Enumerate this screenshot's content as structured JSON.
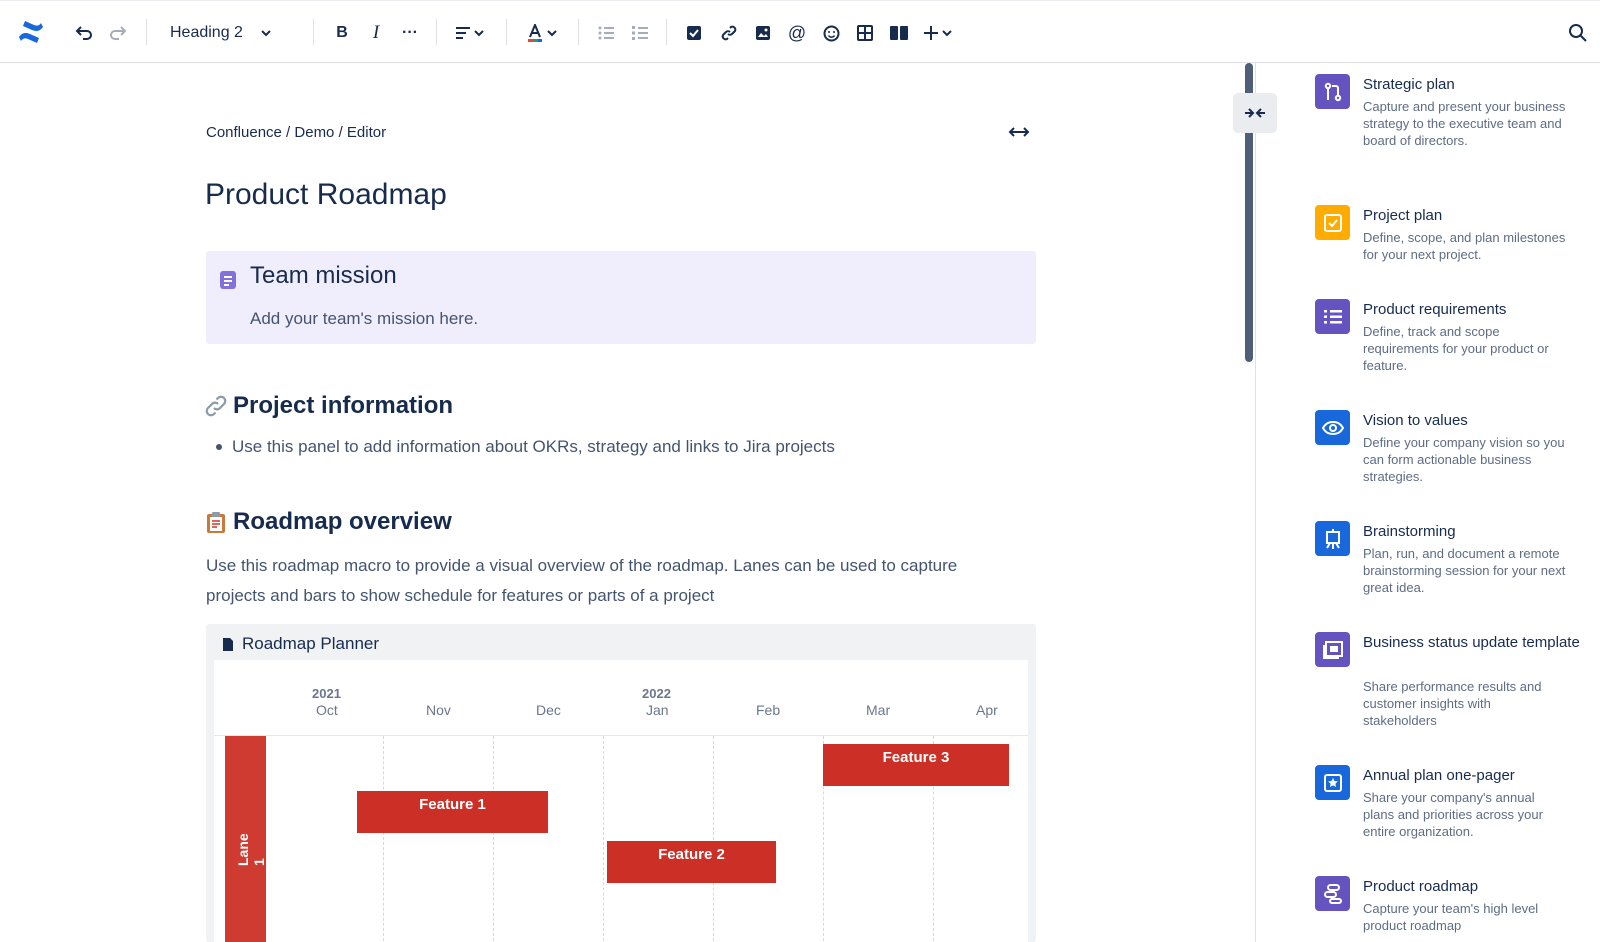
{
  "toolbar": {
    "text_style": "Heading 2",
    "icons": [
      "confluence-logo",
      "undo-icon",
      "redo-icon",
      "bold-icon",
      "italic-icon",
      "more-icon",
      "align-icon",
      "text-color-icon",
      "bullet-list-icon",
      "numbered-list-icon",
      "action-item-icon",
      "link-icon",
      "image-icon",
      "mention-icon",
      "emoji-icon",
      "table-icon",
      "layouts-icon",
      "insert-icon",
      "search-icon"
    ],
    "colors": {
      "accent": "#1868db",
      "icon": "#42526e"
    }
  },
  "editor": {
    "breadcrumb": "Confluence / Demo / Editor",
    "title": "Product Roadmap",
    "mission": {
      "title": "Team mission",
      "text": "Add your team's mission here.",
      "background": "#f0eefd"
    },
    "project_info": {
      "heading": "Project information",
      "bullet": "Use this panel to add information about OKRs, strategy and links to Jira projects"
    },
    "roadmap": {
      "heading": "Roadmap overview",
      "paragraph": "Use this roadmap macro to provide a visual overview of the roadmap. Lanes can be used to capture projects and bars to show schedule for features or parts of a project"
    },
    "planner": {
      "title": "Roadmap Planner",
      "years": [
        "2021",
        "2022"
      ],
      "months": [
        "Oct",
        "Nov",
        "Dec",
        "Jan",
        "Feb",
        "Mar",
        "Apr"
      ],
      "lane": "Lane 1",
      "bars": [
        {
          "label": "Feature 1",
          "start": "Nov",
          "end": "Dec"
        },
        {
          "label": "Feature 2",
          "start": "Jan",
          "end": "Feb"
        },
        {
          "label": "Feature 3",
          "start": "Mar",
          "end": "Apr"
        }
      ],
      "bar_color": "#cc2f25"
    }
  },
  "templates": [
    {
      "title": "Strategic plan",
      "description": "Capture and present your business strategy to the executive team and board of directors.",
      "icon": "strategy-icon",
      "color": "#6554c0"
    },
    {
      "title": "Project plan",
      "description": "Define, scope, and plan milestones for your next project.",
      "icon": "checkbox-icon",
      "color": "#ffab00"
    },
    {
      "title": "Product requirements",
      "description": "Define, track and scope requirements for your product or feature.",
      "icon": "list-icon",
      "color": "#6554c0"
    },
    {
      "title": "Vision to values",
      "description": "Define your company vision so you can form actionable business strategies.",
      "icon": "eye-icon",
      "color": "#1868db"
    },
    {
      "title": "Brainstorming",
      "description": "Plan, run, and document a remote brainstorming session for your next great idea.",
      "icon": "easel-icon",
      "color": "#1868db"
    },
    {
      "title": "Business status update template",
      "description": "Share performance results and customer insights with stakeholders",
      "icon": "status-icon",
      "color": "#6554c0"
    },
    {
      "title": "Annual plan one-pager",
      "description": "Share your company's annual plans and priorities across your entire organization.",
      "icon": "star-page-icon",
      "color": "#1868db"
    },
    {
      "title": "Product roadmap",
      "description": "Capture your team's high level product roadmap",
      "icon": "roadmap-icon",
      "color": "#6554c0"
    }
  ]
}
